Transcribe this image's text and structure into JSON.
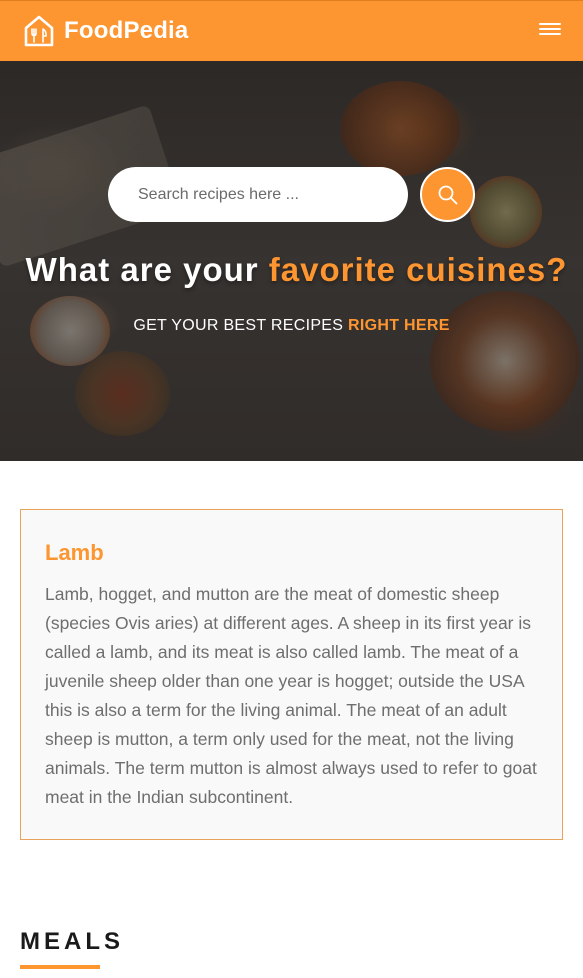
{
  "navbar": {
    "brand": "FoodPedia",
    "logo_icon": "house-utensils-icon",
    "menu_icon": "hamburger-icon"
  },
  "hero": {
    "search_placeholder": "Search recipes here ...",
    "search_icon": "search-icon",
    "title_prefix": "What are your ",
    "title_accent": "favorite cuisines?",
    "subtitle_prefix": "GET YOUR BEST RECIPES ",
    "subtitle_accent": "RIGHT HERE"
  },
  "info": {
    "title": "Lamb",
    "text": "Lamb, hogget, and mutton are the meat of domestic sheep (species Ovis aries) at different ages. A sheep in its first year is called a lamb, and its meat is also called lamb. The meat of a juvenile sheep older than one year is hogget; outside the USA this is also a term for the living animal. The meat of an adult sheep is mutton, a term only used for the meat, not the living animals. The term mutton is almost always used to refer to goat meat in the Indian subcontinent."
  },
  "meals": {
    "heading": "MEALS"
  },
  "colors": {
    "accent": "#fd9530",
    "card_border": "#e8a25a",
    "text_muted": "#6e6e6e"
  }
}
